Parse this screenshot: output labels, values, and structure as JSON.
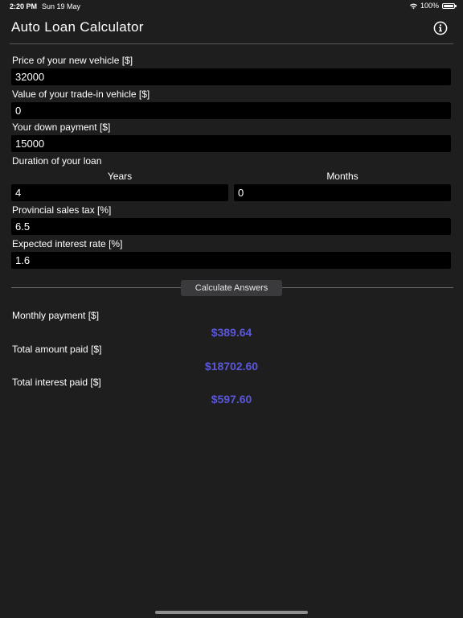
{
  "status_bar": {
    "time": "2:20 PM",
    "date": "Sun 19 May",
    "battery": "100%"
  },
  "nav": {
    "title": "Auto Loan Calculator",
    "info_icon": "info-circle-icon"
  },
  "form": {
    "price": {
      "label": "Price of your new vehicle [$]",
      "value": "32000"
    },
    "trade_in": {
      "label": "Value of your trade-in vehicle [$]",
      "value": "0"
    },
    "down_payment": {
      "label": "Your down payment [$]",
      "value": "15000"
    },
    "duration": {
      "label": "Duration of your loan",
      "years_header": "Years",
      "months_header": "Months",
      "years_value": "4",
      "months_value": "0"
    },
    "sales_tax": {
      "label": "Provincial sales tax [%]",
      "value": "6.5"
    },
    "interest_rate": {
      "label": "Expected interest rate [%]",
      "value": "1.6"
    }
  },
  "calculate": {
    "label": "Calculate Answers"
  },
  "results": {
    "monthly_payment": {
      "label": "Monthly payment [$]",
      "value": "$389.64"
    },
    "total_paid": {
      "label": "Total amount paid [$]",
      "value": "$18702.60"
    },
    "total_interest": {
      "label": "Total interest paid [$]",
      "value": "$597.60"
    }
  },
  "colors": {
    "background": "#1e1e1f",
    "input_background": "#000000",
    "accent": "#5b57d9"
  }
}
